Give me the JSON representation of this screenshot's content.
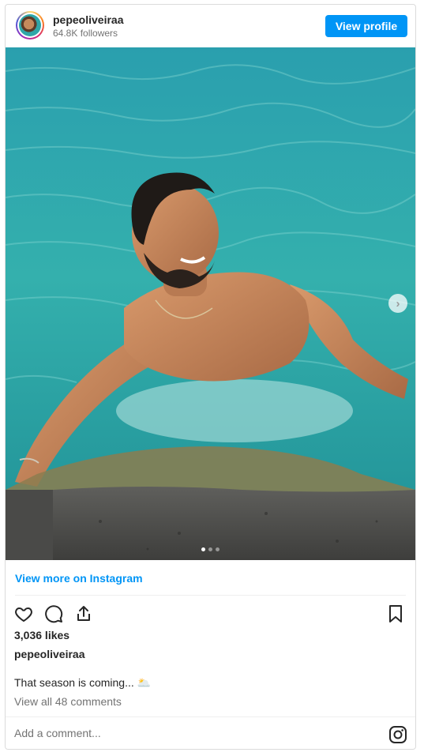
{
  "header": {
    "username": "pepeoliveiraa",
    "followers": "64.8K followers",
    "view_profile_label": "View profile"
  },
  "photo": {
    "description_icon": "photo",
    "carousel_current": 1,
    "carousel_total": 3,
    "next_icon": "chevron-right-icon"
  },
  "footer": {
    "view_more_label": "View more on Instagram",
    "likes": "3,036 likes",
    "caption_username": "pepeoliveiraa",
    "caption_text": "That season is coming... 🌥️",
    "view_comments": "View all 48 comments",
    "comment_placeholder": "Add a comment...",
    "icons": [
      "heart-icon",
      "comment-icon",
      "share-icon",
      "bookmark-icon",
      "instagram-icon"
    ]
  },
  "colors": {
    "accent": "#0095f6",
    "text": "#262626",
    "muted": "#737373",
    "water": "#2fa6a8"
  }
}
